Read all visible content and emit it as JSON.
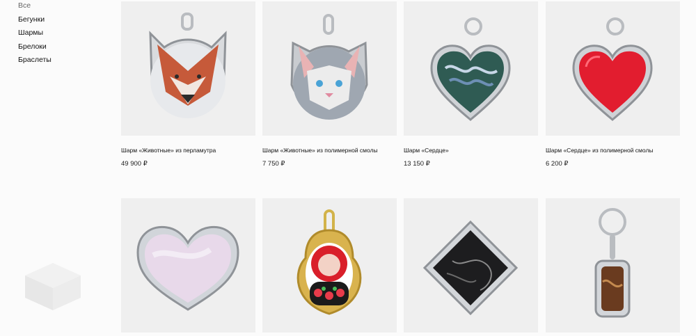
{
  "sidebar": {
    "items": [
      {
        "label": "Все"
      },
      {
        "label": "Бегунки"
      },
      {
        "label": "Шармы"
      },
      {
        "label": "Брелоки"
      },
      {
        "label": "Браслеты"
      }
    ]
  },
  "products": [
    {
      "title": "Шарм «Животные» из перламутра",
      "price": "49 900 ₽",
      "icon": "fox-charm"
    },
    {
      "title": "Шарм «Животные» из полимерной смолы",
      "price": "7 750 ₽",
      "icon": "cat-charm"
    },
    {
      "title": "Шарм «Сердце»",
      "price": "13 150 ₽",
      "icon": "abalone-heart-charm"
    },
    {
      "title": "Шарм «Сердце» из полимерной смолы",
      "price": "6 200 ₽",
      "icon": "red-heart-charm"
    },
    {
      "icon": "pearl-heart-charm"
    },
    {
      "icon": "matryoshka-charm"
    },
    {
      "icon": "marble-diamond-charm"
    },
    {
      "icon": "keychain-rectangle"
    }
  ]
}
